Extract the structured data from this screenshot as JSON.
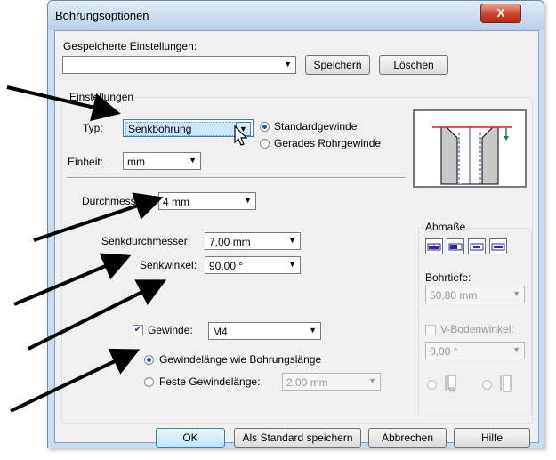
{
  "window": {
    "title": "Bohrungsoptionen",
    "close_label": "X"
  },
  "saved": {
    "label": "Gespeicherte Einstellungen:",
    "value": "",
    "save_button": "Speichern",
    "delete_button": "Löschen"
  },
  "settings": {
    "group_label": "Einstellungen",
    "type_label": "Typ:",
    "type_value": "Senkbohrung",
    "unit_label": "Einheit:",
    "unit_value": "mm",
    "thread_standard": "Standardgewinde",
    "thread_straight_pipe": "Gerades Rohrgewinde",
    "thread_standard_selected": true
  },
  "dimensions_form": {
    "diameter_label": "Durchmesser:",
    "diameter_value": "4 mm",
    "countersink_diameter_label": "Senkdurchmesser:",
    "countersink_diameter_value": "7,00 mm",
    "countersink_angle_label": "Senkwinkel:",
    "countersink_angle_value": "90,00 °"
  },
  "thread": {
    "checkbox_label": "Gewinde:",
    "checked": true,
    "value": "M4",
    "option_hole_length": "Gewindelänge wie Bohrungslänge",
    "option_fixed_length": "Feste Gewindelänge:",
    "fixed_length_value": "2,00 mm"
  },
  "abmasse": {
    "group_label": "Abmaße",
    "depth_label": "Bohrtiefe:",
    "depth_value": "50,80 mm",
    "vbottom_label": "V-Bodenwinkel:",
    "vbottom_value": "0,00 °"
  },
  "footer": {
    "ok": "OK",
    "save_default": "Als Standard speichern",
    "cancel": "Abbrechen",
    "help": "Hilfe"
  },
  "colors": {
    "accent": "#1f57b6",
    "selection": "#cde8fb",
    "preview_line_red": "#d02020",
    "preview_line_blue": "#2040c0",
    "preview_line_green": "#208040"
  }
}
